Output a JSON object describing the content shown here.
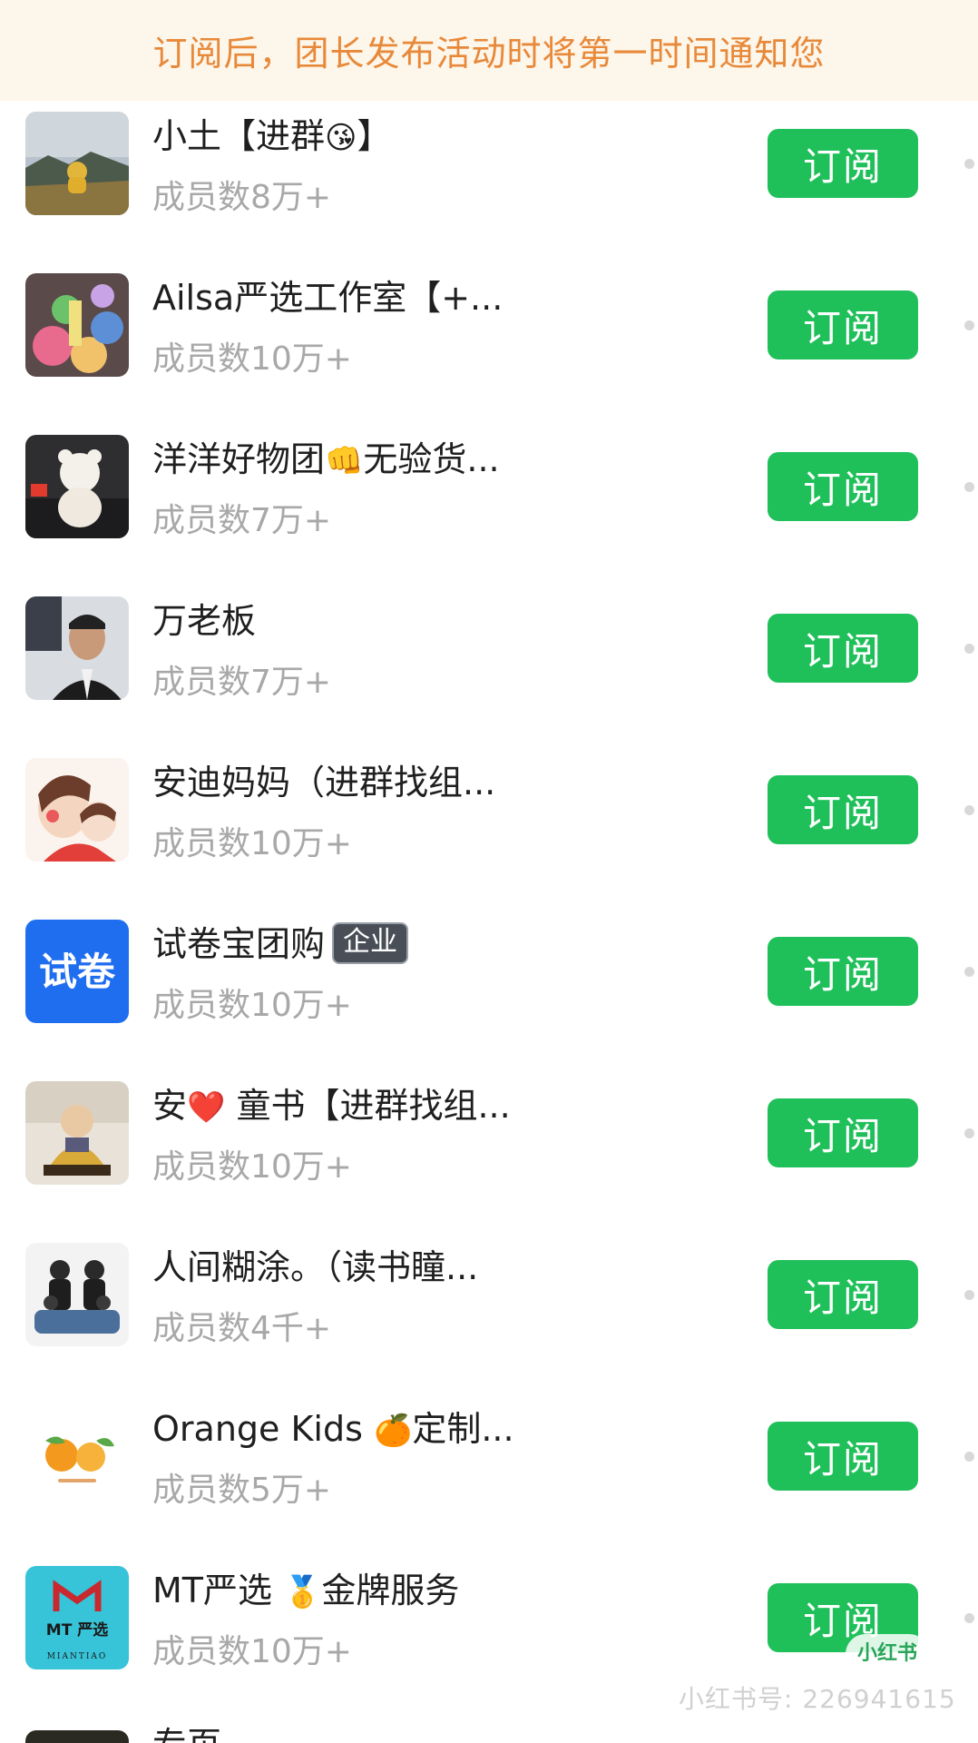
{
  "notice": "订阅后，团长发布活动时将第一时间通知您",
  "subscribe_label": "订阅",
  "groups": [
    {
      "name": "小土【进群",
      "emoji_after": "😘",
      "suffix": "】",
      "members": "成员数8万+",
      "avatar_icon": "landscape-photo"
    },
    {
      "name": "Ailsa严选工作室【+...",
      "members": "成员数10万+",
      "avatar_icon": "colorful-toys-photo"
    },
    {
      "name": "洋洋好物团",
      "emoji_after": "👊",
      "suffix": "无验货...",
      "members": "成员数7万+",
      "avatar_icon": "white-plush-bear-photo"
    },
    {
      "name": "万老板",
      "members": "成员数7万+",
      "avatar_icon": "man-portrait-photo"
    },
    {
      "name": "安迪妈妈（进群找组...",
      "members": "成员数10万+",
      "avatar_icon": "mother-child-illustration"
    },
    {
      "name": "试卷宝团购",
      "badge": "企业",
      "members": "成员数10万+",
      "avatar_icon": "shijuan-logo",
      "avatar_text": "试卷"
    },
    {
      "name": "安",
      "emoji_after": "❤️",
      "suffix": " 童书【进群找组...",
      "members": "成员数10万+",
      "avatar_icon": "monk-figurine-photo"
    },
    {
      "name": "人间糊涂。（读书瞳...",
      "members": "成员数4千+",
      "avatar_icon": "family-photo"
    },
    {
      "name": "Orange Kids ",
      "emoji_after": "🍊",
      "suffix": "定制...",
      "members": "成员数5万+",
      "avatar_icon": "orange-kids-logo"
    },
    {
      "name": "MT严选 ",
      "emoji_after": "🥇",
      "suffix": "金牌服务",
      "members": "成员数10万+",
      "avatar_icon": "mt-yanxuan-logo",
      "avatar_text": "MT 严选",
      "avatar_subtext": "MIANTIAO"
    }
  ],
  "peek_text": "专页",
  "watermark": "小红书号: 226941615",
  "watermark_logo": "小红书",
  "colors": {
    "notice_bg": "#fdf6ea",
    "notice_text": "#e8893a",
    "button_green": "#1fc05a",
    "member_gray": "#a8a8a8",
    "badge_bg": "#4a4f57"
  }
}
